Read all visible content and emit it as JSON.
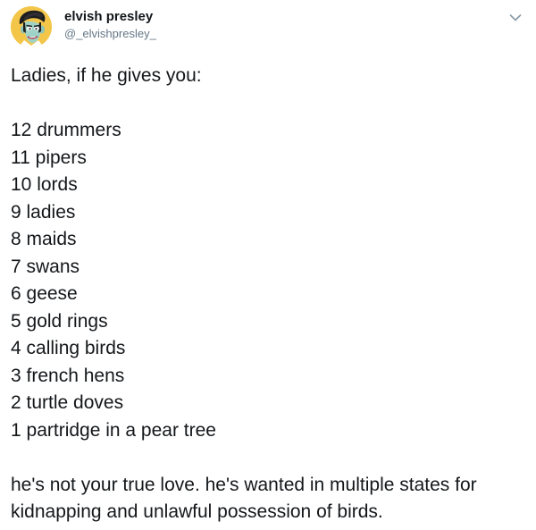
{
  "author": {
    "display_name": "elvish presley",
    "handle": "@_elvishpresley_"
  },
  "icons": {
    "avatar": "elvis-cartoon-avatar",
    "menu": "chevron-down-icon"
  },
  "colors": {
    "text": "#14171a",
    "secondary_text": "#657786",
    "avatar_background": "#f3c64a",
    "caret": "#8899a6"
  },
  "tweet": {
    "intro": "Ladies, if he gives you:",
    "list": [
      "12 drummers",
      "11 pipers",
      "10 lords",
      "9 ladies",
      "8 maids",
      "7 swans",
      "6 geese",
      "5 gold rings",
      "4 calling birds",
      "3 french hens",
      "2 turtle doves",
      "1 partridge in a pear tree"
    ],
    "closing": "he's not your true love. he's wanted in multiple states for kidnapping and unlawful possession of birds."
  }
}
